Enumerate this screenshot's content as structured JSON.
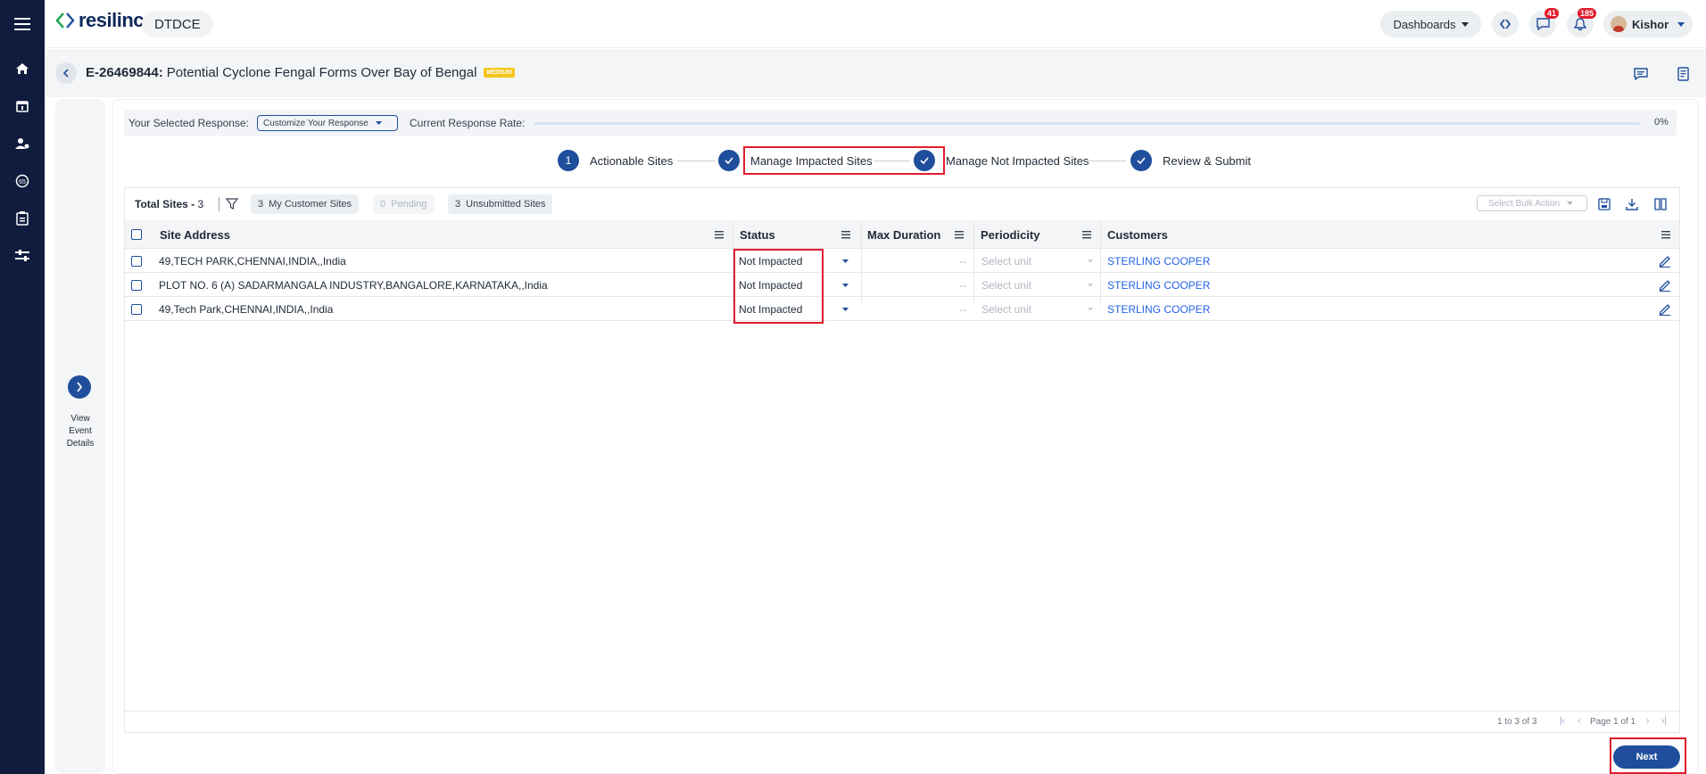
{
  "app": {
    "logo_text": "resilinc",
    "org": "DTDCE"
  },
  "topbar": {
    "dashboards_label": "Dashboards",
    "messages_badge": "41",
    "notifications_badge": "185",
    "user_name": "Kishor"
  },
  "event": {
    "id": "E-26469844:",
    "title": "Potential Cyclone Fengal Forms Over Bay of Bengal",
    "severity": "MEDIUM"
  },
  "left_panel": {
    "line1": "View",
    "line2": "Event",
    "line3": "Details"
  },
  "response": {
    "selected_label": "Your Selected Response:",
    "selected_value": "Customize Your Response",
    "rate_label": "Current Response Rate:",
    "rate_value": "0%",
    "rate_fraction": 0
  },
  "steps": [
    {
      "marker": "1",
      "label": "Actionable Sites"
    },
    {
      "marker": "check",
      "label": "Manage Impacted Sites"
    },
    {
      "marker": "check",
      "label": "Manage Not Impacted Sites"
    },
    {
      "marker": "check",
      "label": "Review & Submit"
    }
  ],
  "table_toolbar": {
    "total_label": "Total Sites -",
    "total_value": "3",
    "chips": [
      {
        "count": "3",
        "label": "My Customer Sites"
      },
      {
        "count": "0",
        "label": "Pending"
      },
      {
        "count": "3",
        "label": "Unsubmitted Sites"
      }
    ],
    "bulk_placeholder": "Select Bulk Action"
  },
  "columns": [
    "Site Address",
    "Status",
    "Max Duration",
    "Periodicity",
    "Customers"
  ],
  "rows": [
    {
      "address": "49,TECH PARK,CHENNAI,INDIA,,India",
      "status": "Not Impacted",
      "duration": "--",
      "periodicity": "Select unit",
      "customer": "STERLING COOPER"
    },
    {
      "address": "PLOT NO. 6 (A) SADARMANGALA INDUSTRY,BANGALORE,KARNATAKA,,India",
      "status": "Not Impacted",
      "duration": "--",
      "periodicity": "Select unit",
      "customer": "STERLING COOPER"
    },
    {
      "address": "49,Tech Park,CHENNAI,INDIA,,India",
      "status": "Not Impacted",
      "duration": "--",
      "periodicity": "Select unit",
      "customer": "STERLING COOPER"
    }
  ],
  "footer": {
    "range": "1 to 3 of 3",
    "page": "Page 1 of 1"
  },
  "next_label": "Next",
  "colors": {
    "rail": "#0f1c3d",
    "primary": "#1f4e9c",
    "highlight": "#e11d2e",
    "link": "#2563eb"
  }
}
